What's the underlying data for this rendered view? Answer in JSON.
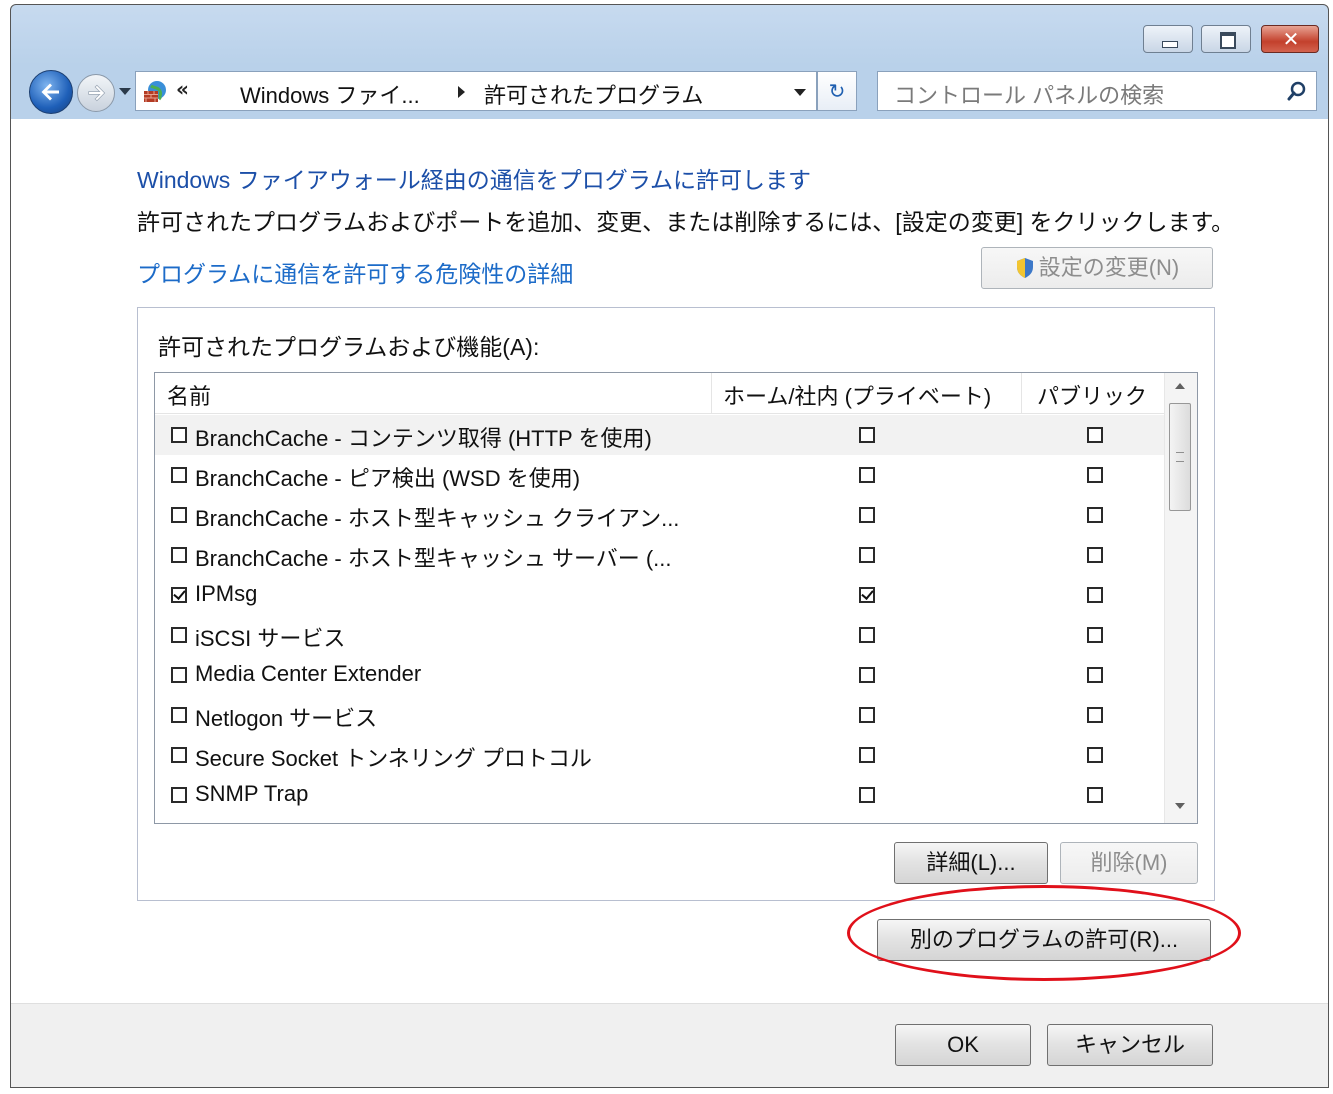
{
  "window": {
    "controls": {
      "minimize": "minimize-icon",
      "maximize": "maximize-icon",
      "close": "close-icon"
    }
  },
  "navbar": {
    "address": {
      "chevron": "«",
      "segment1": "Windows ファイ...",
      "segment2": "許可されたプログラム"
    },
    "refresh_glyph": "↻",
    "search": {
      "placeholder": "コントロール パネルの検索"
    }
  },
  "content": {
    "heading": "Windows ファイアウォール経由の通信をプログラムに許可します",
    "instruction": "許可されたプログラムおよびポートを追加、変更、または削除するには、[設定の変更] をクリックします。",
    "risk_link": "プログラムに通信を許可する危険性の詳細",
    "change_settings": "設定の変更(N)",
    "group_label": "許可されたプログラムおよび機能(A):",
    "columns": {
      "name": "名前",
      "home": "ホーム/社内 (プライベート)",
      "public": "パブリック"
    },
    "rows": [
      {
        "name": "BranchCache - コンテンツ取得 (HTTP を使用)",
        "enabled": false,
        "home": false,
        "public": false
      },
      {
        "name": "BranchCache - ピア検出 (WSD を使用)",
        "enabled": false,
        "home": false,
        "public": false
      },
      {
        "name": "BranchCache - ホスト型キャッシュ クライアン...",
        "enabled": false,
        "home": false,
        "public": false
      },
      {
        "name": "BranchCache - ホスト型キャッシュ サーバー (...",
        "enabled": false,
        "home": false,
        "public": false
      },
      {
        "name": "IPMsg",
        "enabled": true,
        "home": true,
        "public": false
      },
      {
        "name": "iSCSI サービス",
        "enabled": false,
        "home": false,
        "public": false
      },
      {
        "name": "Media Center Extender",
        "enabled": false,
        "home": false,
        "public": false
      },
      {
        "name": "Netlogon サービス",
        "enabled": false,
        "home": false,
        "public": false
      },
      {
        "name": "Secure Socket トンネリング プロトコル",
        "enabled": false,
        "home": false,
        "public": false
      },
      {
        "name": "SNMP Trap",
        "enabled": false,
        "home": false,
        "public": false
      }
    ],
    "details_button": "詳細(L)...",
    "delete_button": "削除(M)",
    "allow_another_button": "別のプログラムの許可(R)..."
  },
  "footer": {
    "ok": "OK",
    "cancel": "キャンセル"
  },
  "colors": {
    "link": "#1c6bc8",
    "heading": "#1c4fa8",
    "highlight_circle": "#e0101a"
  }
}
